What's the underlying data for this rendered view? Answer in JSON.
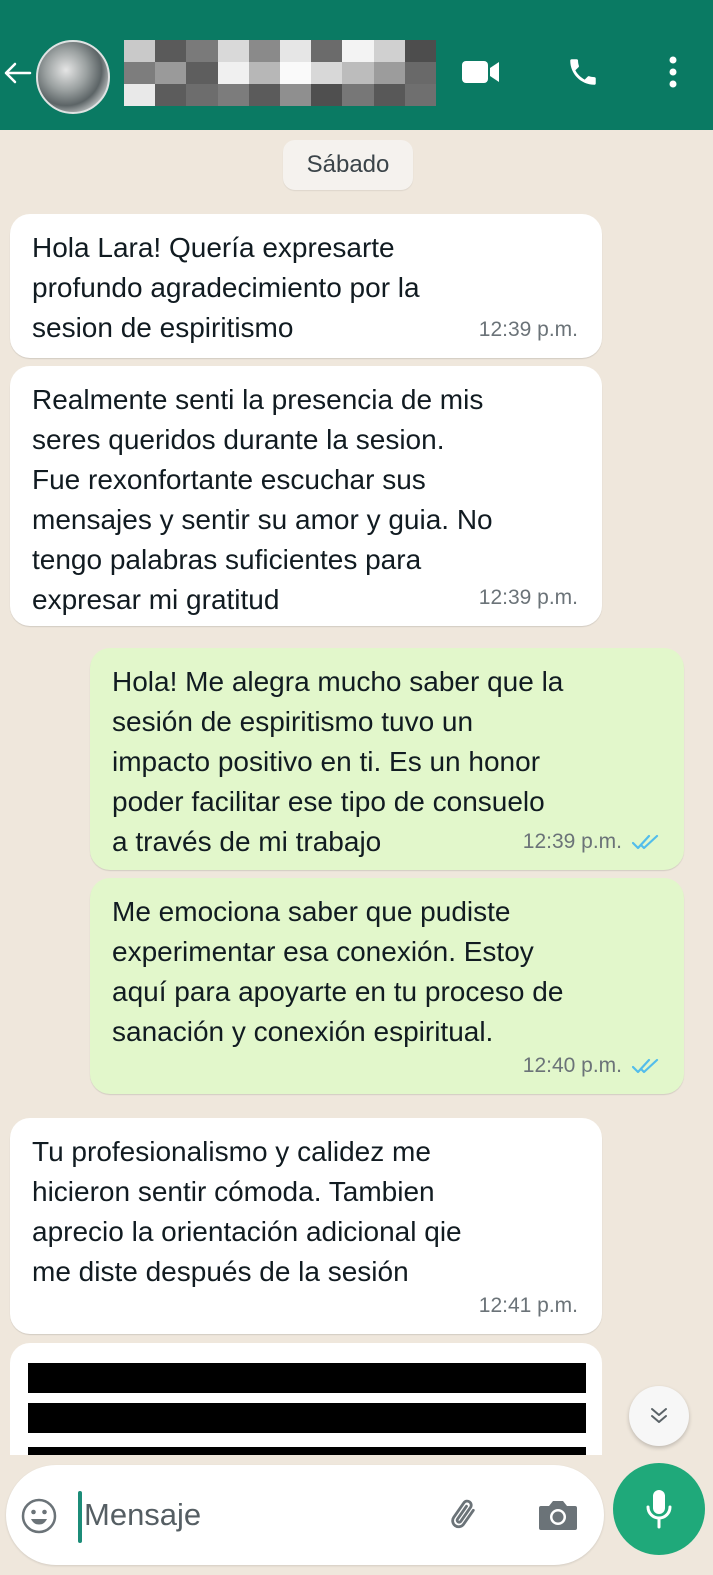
{
  "header": {
    "contact_name": "",
    "colors": {
      "bar": "#0a7a63",
      "icons": "#ffffff"
    },
    "icons": [
      "back-arrow-icon",
      "video-call-icon",
      "voice-call-icon",
      "more-options-icon"
    ]
  },
  "chat": {
    "date_label": "Sábado",
    "messages": [
      {
        "direction": "in",
        "text": "Hola Lara! Quería expresarte\nprofundo agradecimiento por la\nsesion de espiritismo",
        "time": "12:39 p.m."
      },
      {
        "direction": "in",
        "text": "Realmente senti la presencia de mis\nseres queridos durante la sesion.\nFue rexonfortante escuchar sus\nmensajes y sentir su amor y guia. No\ntengo palabras suficientes para\nexpresar mi gratitud",
        "time": "12:39 p.m."
      },
      {
        "direction": "out",
        "text": "Hola! Me alegra mucho saber que la\nsesión de espiritismo tuvo un\nimpacto positivo en ti. Es un honor\npoder facilitar ese tipo de consuelo\na través de mi trabajo",
        "time": "12:39 p.m.",
        "status": "read"
      },
      {
        "direction": "out",
        "text": "Me emociona saber que pudiste\nexperimentar esa conexión. Estoy\naquí para apoyarte en tu proceso de\nsanación y conexión espiritual.",
        "time": "12:40 p.m.",
        "status": "read"
      },
      {
        "direction": "in",
        "text": "Tu profesionalismo y calidez me\nhicieron sentir cómoda. Tambien\naprecio la orientación adicional qie\nme diste después de la sesión",
        "time": "12:41 p.m."
      }
    ],
    "colors": {
      "incoming": "#ffffff",
      "outgoing": "#e2f7cb",
      "read_ticks": "#53bdeb"
    }
  },
  "composer": {
    "placeholder": "Mensaje",
    "icons": [
      "emoji-icon",
      "attach-icon",
      "camera-icon",
      "mic-icon"
    ],
    "mic_color": "#1fa97a"
  }
}
